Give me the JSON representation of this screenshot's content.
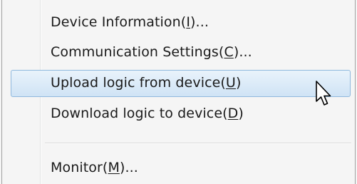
{
  "menu": {
    "items": [
      {
        "prefix": "Device Information(",
        "mnemonic": "I",
        "suffix": ")..."
      },
      {
        "prefix": "Communication Settings(",
        "mnemonic": "C",
        "suffix": ")..."
      },
      {
        "prefix": "Upload logic from device(",
        "mnemonic": "U",
        "suffix": ")"
      },
      {
        "prefix": "Download logic to device(",
        "mnemonic": "D",
        "suffix": ")"
      },
      {
        "prefix": "Monitor(",
        "mnemonic": "M",
        "suffix": ")..."
      }
    ],
    "highlighted_index": 2
  },
  "cursor": {
    "icon": "arrow-pointer-icon"
  },
  "colors": {
    "highlight_border": "#8fb8dd",
    "highlight_fill": "#dcebf8"
  }
}
